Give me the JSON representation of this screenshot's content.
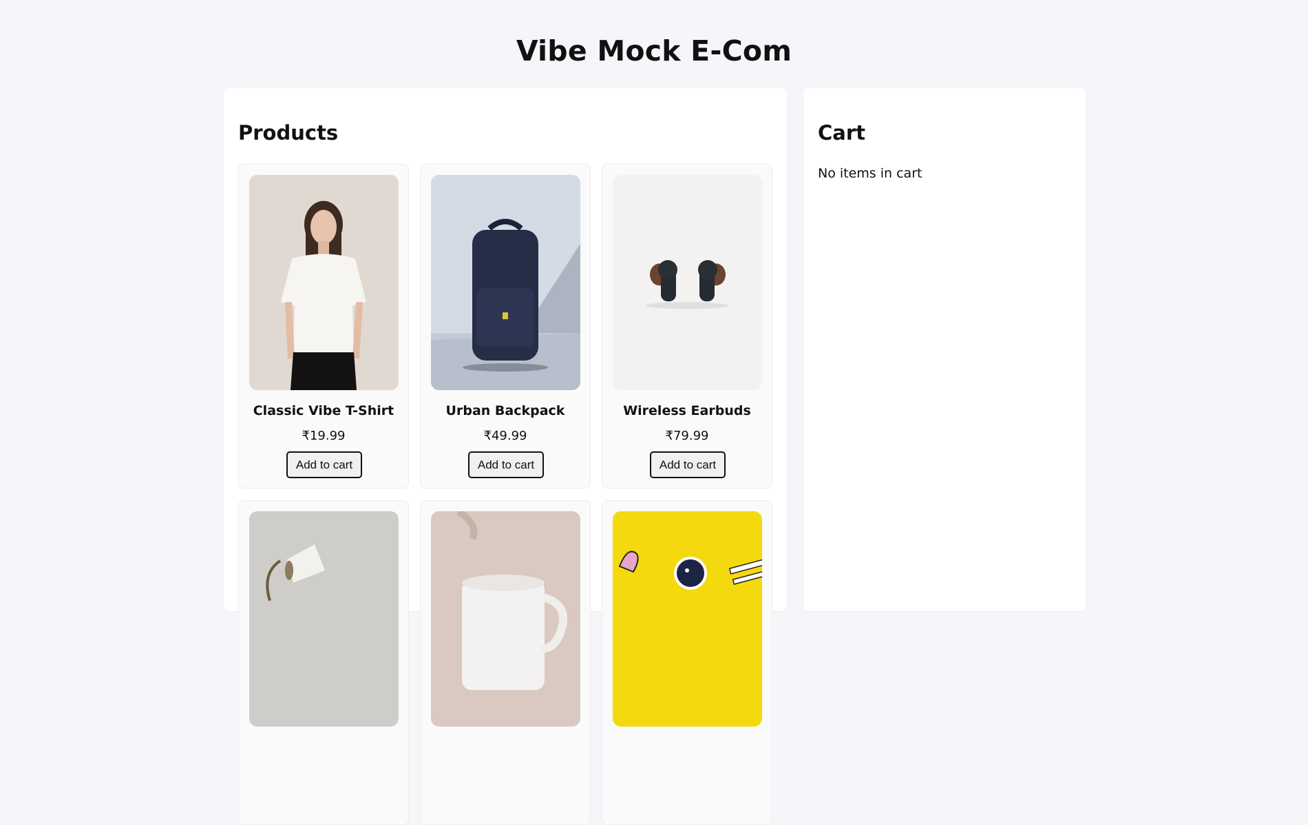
{
  "site": {
    "title": "Vibe Mock E-Com"
  },
  "products": {
    "heading": "Products",
    "items": [
      {
        "name": "Classic Vibe T-Shirt",
        "price": "₹19.99",
        "button": "Add to cart",
        "image": "tshirt-photo"
      },
      {
        "name": "Urban Backpack",
        "price": "₹49.99",
        "button": "Add to cart",
        "image": "backpack-photo"
      },
      {
        "name": "Wireless Earbuds",
        "price": "₹79.99",
        "button": "Add to cart",
        "image": "earbuds-photo"
      },
      {
        "image": "lamp-photo"
      },
      {
        "image": "mug-photo"
      },
      {
        "image": "stickers-photo"
      }
    ]
  },
  "cart": {
    "heading": "Cart",
    "empty_text": "No items in cart"
  }
}
